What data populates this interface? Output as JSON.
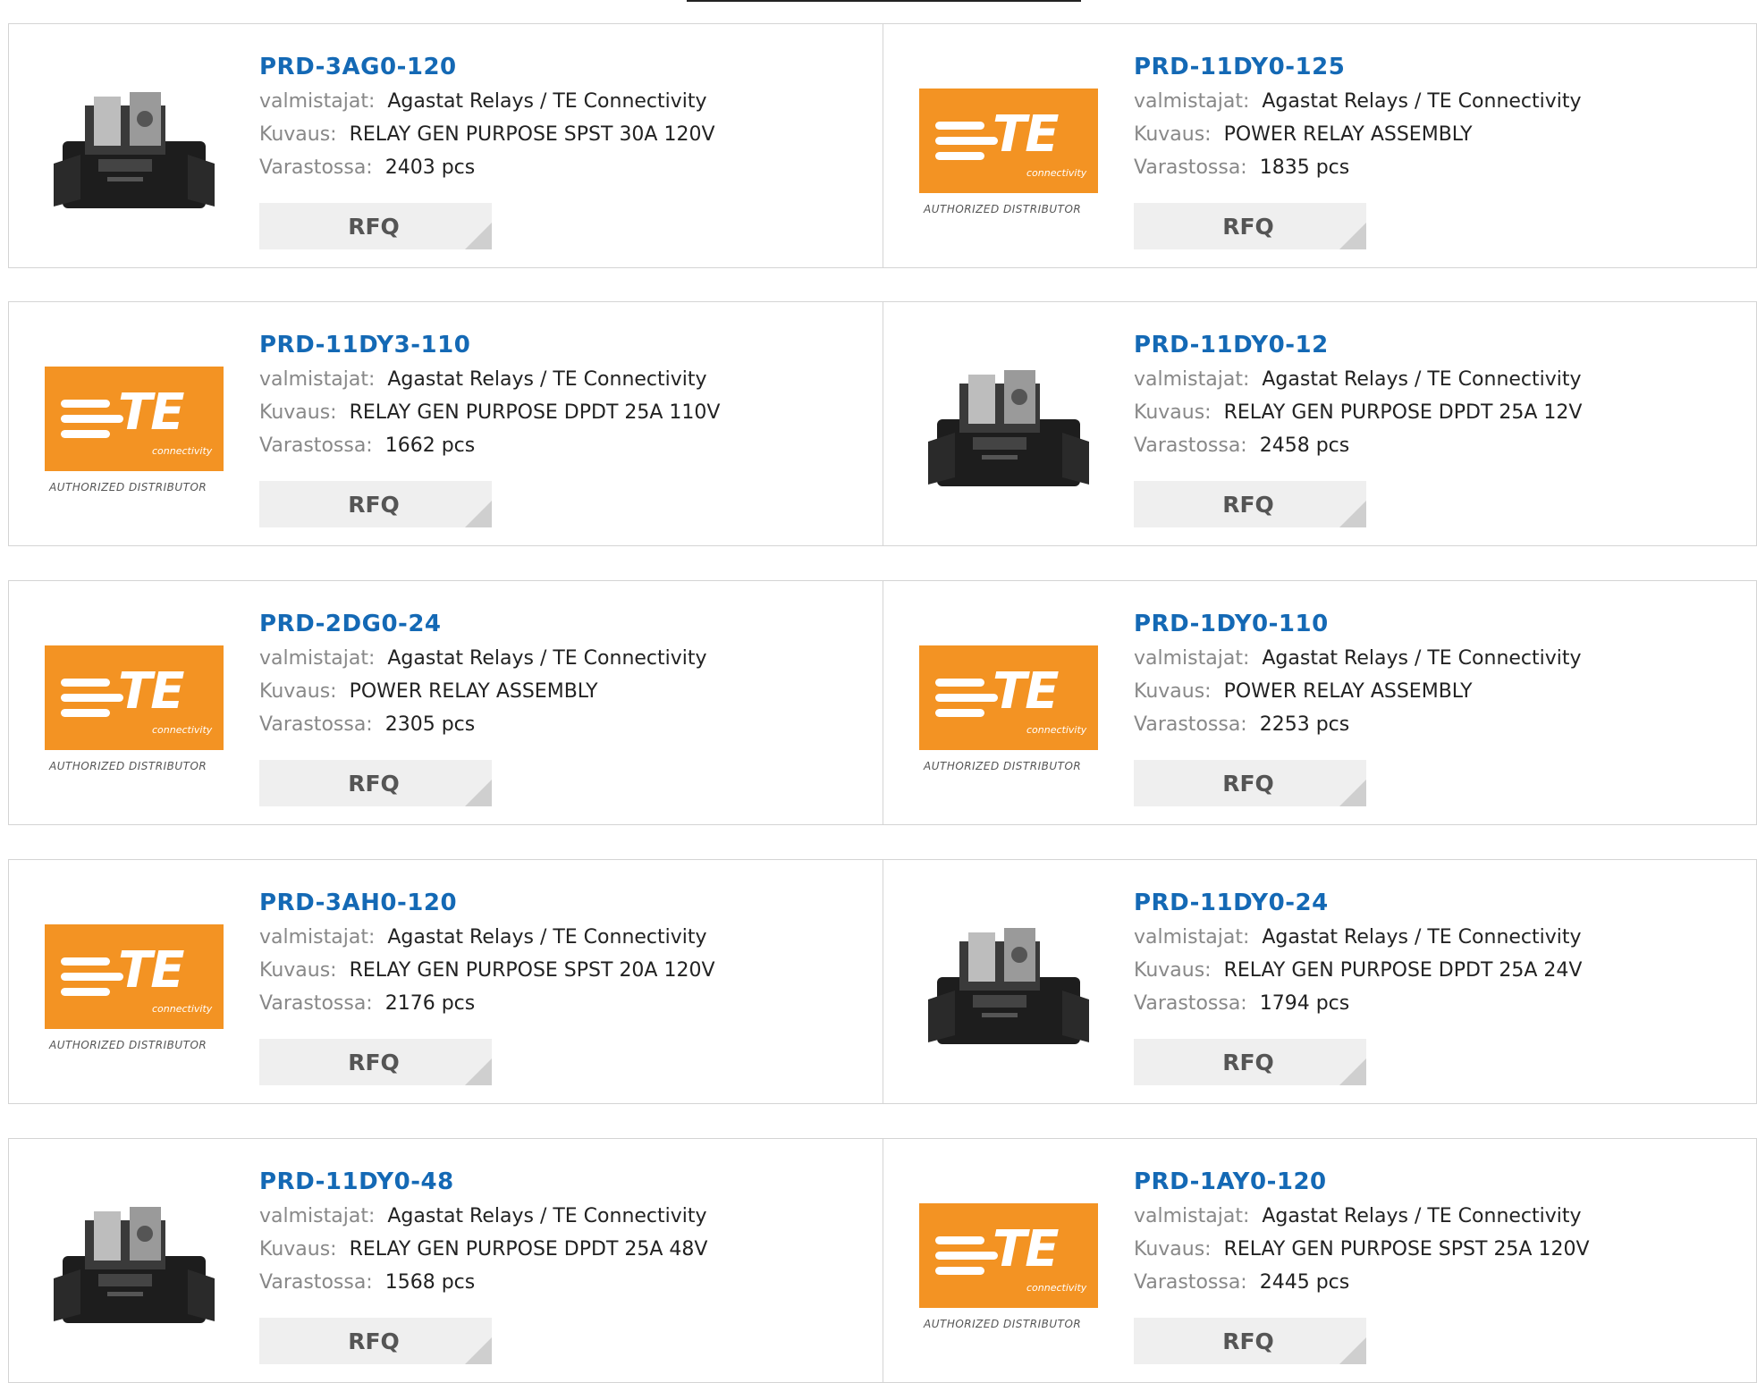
{
  "labels": {
    "manufacturer": "valmistajat:",
    "description": "Kuvaus:",
    "stock": "Varastossa:",
    "rfq": "RFQ",
    "te_letters": "TE",
    "te_sub": "connectivity",
    "authorized": "AUTHORIZED DISTRIBUTOR"
  },
  "rows": [
    {
      "left": {
        "part": "PRD-3AG0-120",
        "image": "relay-photo",
        "manufacturer": "Agastat Relays / TE Connectivity",
        "description": "RELAY GEN PURPOSE SPST 30A 120V",
        "stock": "2403 pcs"
      },
      "right": {
        "part": "PRD-11DY0-125",
        "image": "te-logo",
        "manufacturer": "Agastat Relays / TE Connectivity",
        "description": "POWER RELAY ASSEMBLY",
        "stock": "1835 pcs"
      }
    },
    {
      "left": {
        "part": "PRD-11DY3-110",
        "image": "te-logo",
        "manufacturer": "Agastat Relays / TE Connectivity",
        "description": "RELAY GEN PURPOSE DPDT 25A 110V",
        "stock": "1662 pcs"
      },
      "right": {
        "part": "PRD-11DY0-12",
        "image": "relay-photo",
        "manufacturer": "Agastat Relays / TE Connectivity",
        "description": "RELAY GEN PURPOSE DPDT 25A 12V",
        "stock": "2458 pcs"
      }
    },
    {
      "left": {
        "part": "PRD-2DG0-24",
        "image": "te-logo",
        "manufacturer": "Agastat Relays / TE Connectivity",
        "description": "POWER RELAY ASSEMBLY",
        "stock": "2305 pcs"
      },
      "right": {
        "part": "PRD-1DY0-110",
        "image": "te-logo",
        "manufacturer": "Agastat Relays / TE Connectivity",
        "description": "POWER RELAY ASSEMBLY",
        "stock": "2253 pcs"
      }
    },
    {
      "left": {
        "part": "PRD-3AH0-120",
        "image": "te-logo",
        "manufacturer": "Agastat Relays / TE Connectivity",
        "description": "RELAY GEN PURPOSE SPST 20A 120V",
        "stock": "2176 pcs"
      },
      "right": {
        "part": "PRD-11DY0-24",
        "image": "relay-photo",
        "manufacturer": "Agastat Relays / TE Connectivity",
        "description": "RELAY GEN PURPOSE DPDT 25A 24V",
        "stock": "1794 pcs"
      }
    },
    {
      "left": {
        "part": "PRD-11DY0-48",
        "image": "relay-photo",
        "manufacturer": "Agastat Relays / TE Connectivity",
        "description": "RELAY GEN PURPOSE DPDT 25A 48V",
        "stock": "1568 pcs"
      },
      "right": {
        "part": "PRD-1AY0-120",
        "image": "te-logo",
        "manufacturer": "Agastat Relays / TE Connectivity",
        "description": "RELAY GEN PURPOSE SPST 25A 120V",
        "stock": "2445 pcs"
      }
    }
  ]
}
